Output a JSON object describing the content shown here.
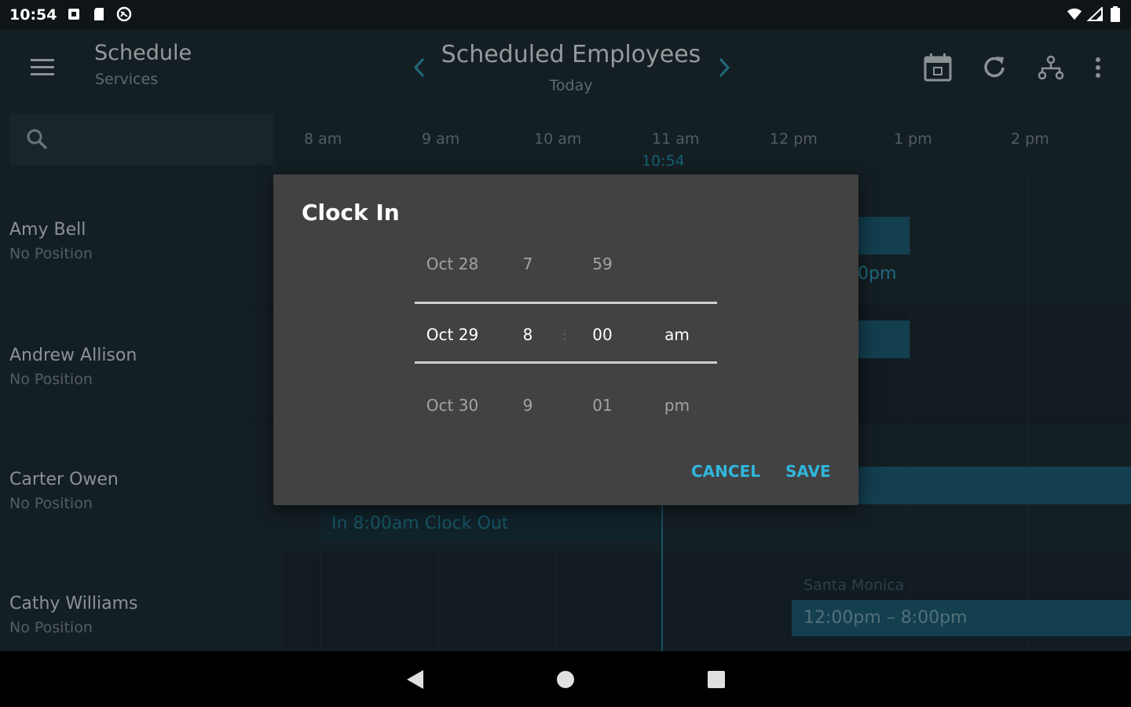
{
  "status_bar": {
    "time": "10:54",
    "icons": [
      "notification-icon",
      "sd-card-icon",
      "sync-icon"
    ],
    "right_icons": [
      "wifi-icon",
      "cell-signal-icon",
      "battery-icon"
    ]
  },
  "app_bar": {
    "title": "Schedule",
    "subtitle": "Services",
    "center_title": "Scheduled Employees",
    "center_subtitle": "Today",
    "actions": [
      "calendar-icon",
      "refresh-icon",
      "hierarchy-icon",
      "more-vert-icon"
    ]
  },
  "timeline": {
    "hours": [
      "8 am",
      "9 am",
      "10 am",
      "11 am",
      "12 pm",
      "1 pm",
      "2 pm"
    ],
    "now_label": "10:54"
  },
  "employees": [
    {
      "name": "Amy Bell",
      "position": "No Position"
    },
    {
      "name": "Andrew Allison",
      "position": "No Position"
    },
    {
      "name": "Carter Owen",
      "position": "No Position"
    },
    {
      "name": "Cathy Williams",
      "position": "No Position"
    }
  ],
  "shifts": {
    "amy_partial_text": "0pm",
    "carter_clock": "In  8:00am  Clock Out",
    "cathy_location": "Santa Monica",
    "cathy_time": "12:00pm – 8:00pm"
  },
  "dialog": {
    "title": "Clock In",
    "picker": {
      "prev": {
        "date": "Oct 28",
        "hour": "7",
        "minute": "59",
        "ampm": ""
      },
      "selected": {
        "date": "Oct 29",
        "hour": "8",
        "minute": "00",
        "ampm": "am"
      },
      "next": {
        "date": "Oct 30",
        "hour": "9",
        "minute": "01",
        "ampm": "pm"
      },
      "separator": ":"
    },
    "cancel_label": "CANCEL",
    "save_label": "SAVE"
  },
  "colors": {
    "accent": "#30b6dc",
    "shift": "#1a5468",
    "dialog_bg": "#424242"
  }
}
